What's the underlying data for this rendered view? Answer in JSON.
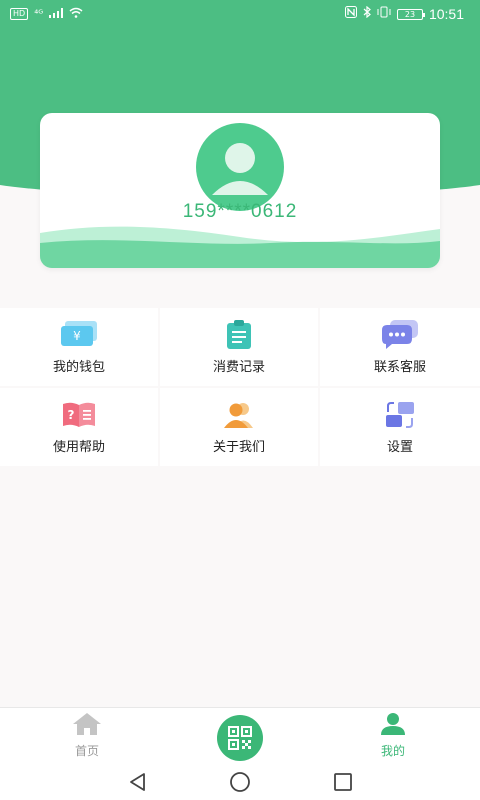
{
  "status_bar": {
    "left_badge": "HD",
    "signal_text": "⁴ᴳ",
    "battery_level": "23",
    "time": "10:51"
  },
  "colors": {
    "brand_green": "#3bb777",
    "header_green": "#4cbe83",
    "light_green": "#a8e8c8"
  },
  "profile": {
    "avatar_icon": "user-avatar-icon",
    "phone": "159****0612"
  },
  "menu": [
    {
      "label": "我的钱包",
      "icon": "wallet-icon"
    },
    {
      "label": "消费记录",
      "icon": "clipboard-icon"
    },
    {
      "label": "联系客服",
      "icon": "chat-icon"
    },
    {
      "label": "使用帮助",
      "icon": "help-book-icon"
    },
    {
      "label": "关于我们",
      "icon": "users-icon"
    },
    {
      "label": "设置",
      "icon": "settings-swap-icon"
    }
  ],
  "bottom_nav": {
    "home_label": "首页",
    "scan_icon": "qr-code-icon",
    "mine_label": "我的"
  },
  "system_nav": {
    "back_icon": "back-triangle-icon",
    "home_icon": "home-circle-icon",
    "recent_icon": "recent-square-icon"
  }
}
